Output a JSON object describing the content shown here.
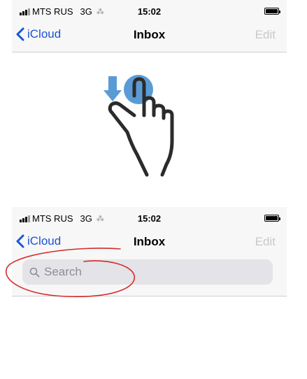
{
  "screens": {
    "top": {
      "status": {
        "carrier": "MTS RUS",
        "network": "3G",
        "time": "15:02"
      },
      "nav": {
        "back_label": "iCloud",
        "title": "Inbox",
        "edit_label": "Edit"
      }
    },
    "bottom": {
      "status": {
        "carrier": "MTS RUS",
        "network": "3G",
        "time": "15:02"
      },
      "nav": {
        "back_label": "iCloud",
        "title": "Inbox",
        "edit_label": "Edit"
      },
      "search": {
        "placeholder": "Search"
      }
    }
  },
  "colors": {
    "accent": "#1a55d6",
    "disabled": "#c9c9cc",
    "gesture_arrow": "#5b9bd5",
    "annotation": "#d52b2b"
  },
  "icons": [
    "chevron-left-icon",
    "search-icon",
    "battery-icon",
    "signal-icon",
    "pull-down-gesture-icon"
  ]
}
